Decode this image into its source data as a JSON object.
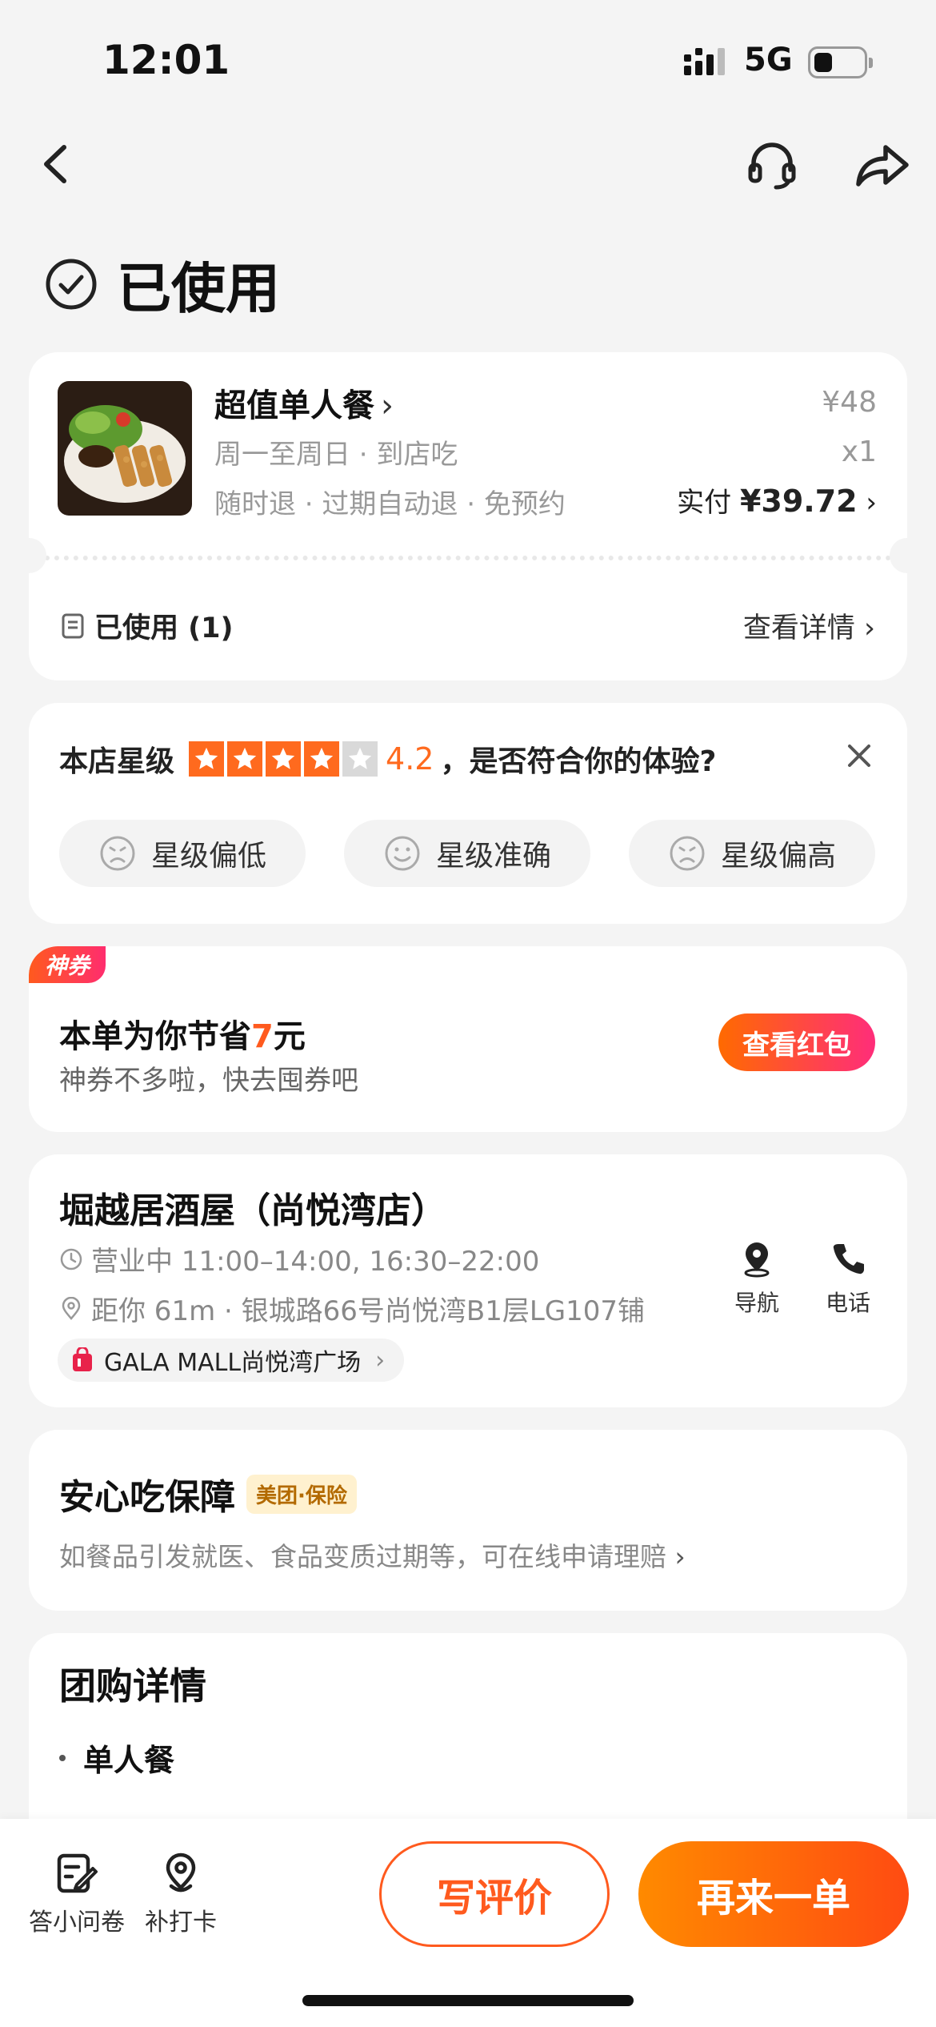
{
  "status_bar": {
    "time": "12:01",
    "network": "5G"
  },
  "page_status": {
    "title": "已使用"
  },
  "order": {
    "deal_name": "超值单人餐",
    "meta_line1": "周一至周日 · 到店吃",
    "meta_line2": "随时退 · 过期自动退 · 免预约",
    "original_price": "¥48",
    "quantity": "x1",
    "paid_label": "实付",
    "paid_amount": "¥39.72",
    "used_label": "已使用 (1)",
    "view_details": "查看详情"
  },
  "rating": {
    "label": "本店星级",
    "score": "4.2",
    "stars_filled": 4,
    "stars_total": 5,
    "question": "，是否符合你的体验?",
    "chips": [
      "星级偏低",
      "星级准确",
      "星级偏高"
    ]
  },
  "coupon": {
    "tag": "神券",
    "title_prefix": "本单为你节省",
    "amount": "7",
    "title_suffix": "元",
    "subtitle": "神券不多啦，快去囤券吧",
    "button": "查看红包"
  },
  "shop": {
    "name": "堀越居酒屋（尚悦湾店）",
    "hours": "营业中 11:00–14:00, 16:30–22:00",
    "address": "距你 61m · 银城路66号尚悦湾B1层LG107铺",
    "mall": "GALA MALL尚悦湾广场",
    "nav_label": "导航",
    "call_label": "电话"
  },
  "insurance": {
    "title": "安心吃保障",
    "badge": "美团·保险",
    "description": "如餐品引发就医、食品变质过期等，可在线申请理赔"
  },
  "group_detail": {
    "title": "团购详情",
    "items": [
      "单人餐"
    ]
  },
  "bottom_bar": {
    "survey_label": "答小问卷",
    "checkin_label": "补打卡",
    "review_button": "写评价",
    "reorder_button": "再来一单"
  },
  "colors": {
    "accent": "#ff5a1e",
    "star": "#ff6a1e"
  }
}
